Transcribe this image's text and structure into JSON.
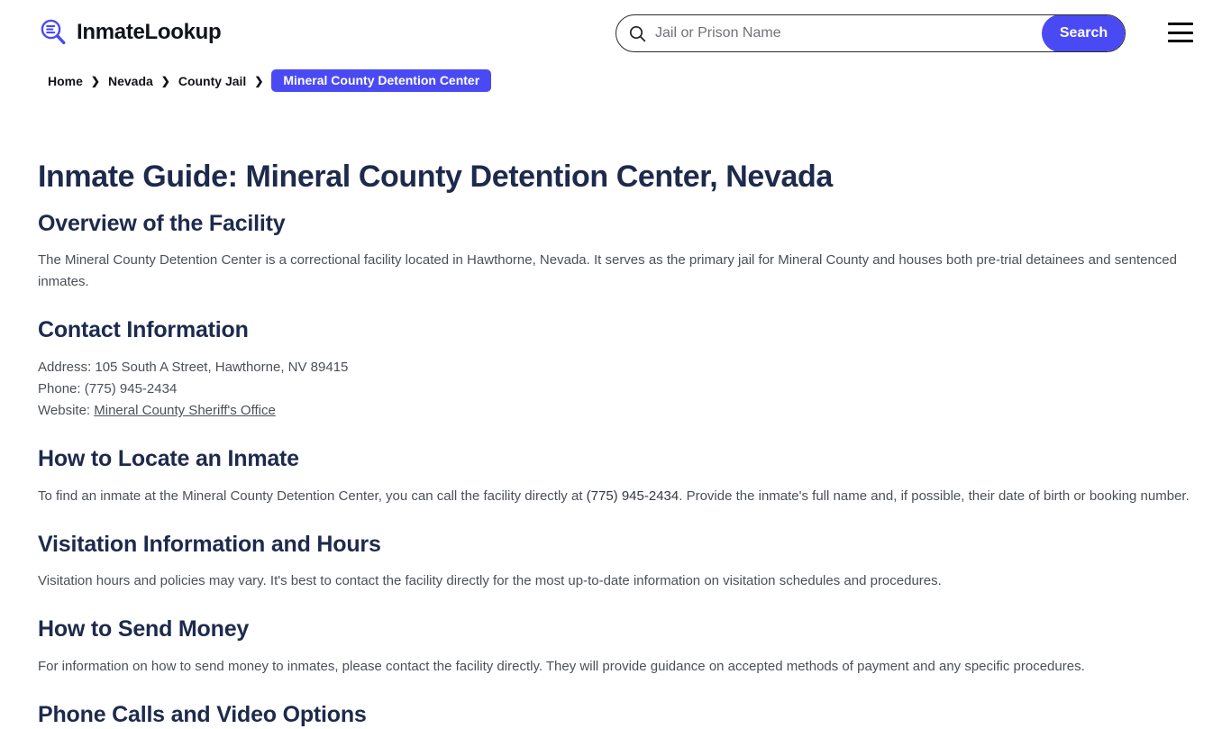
{
  "header": {
    "brand_name": "InmateLookup",
    "logo_icon": "magnifier-list-icon",
    "search": {
      "icon": "search-icon",
      "placeholder": "Jail or Prison Name",
      "value": "",
      "button_label": "Search"
    },
    "menu_icon": "hamburger-menu-icon",
    "accent_color": "#4a4af4"
  },
  "breadcrumb": {
    "items": [
      {
        "label": "Home"
      },
      {
        "label": "Nevada"
      },
      {
        "label": "County Jail"
      }
    ],
    "separator": "❯",
    "current": "Mineral County Detention Center"
  },
  "main": {
    "page_title": "Inmate Guide: Mineral County Detention Center, Nevada",
    "sections": [
      {
        "heading": "Overview of the Facility",
        "body": "The Mineral County Detention Center is a correctional facility located in Hawthorne, Nevada. It serves as the primary jail for Mineral County and houses both pre-trial detainees and sentenced inmates."
      },
      {
        "heading": "Contact Information",
        "address_line": "Address: 105 South A Street, Hawthorne, NV 89415",
        "phone_line": "Phone: (775) 945-2434",
        "website_label": "Website:",
        "website_link_text": "Mineral County Sheriff's Office"
      },
      {
        "heading": "How to Locate an Inmate",
        "body_before": "To find an inmate at the Mineral County Detention Center, you can call the facility directly at ",
        "body_phone": "(775) 945-2434",
        "body_after": ". Provide the inmate's full name and, if possible, their date of birth or booking number."
      },
      {
        "heading": "Visitation Information and Hours",
        "body": "Visitation hours and policies may vary. It's best to contact the facility directly for the most up-to-date information on visitation schedules and procedures."
      },
      {
        "heading": "How to Send Money",
        "body": "For information on how to send money to inmates, please contact the facility directly. They will provide guidance on accepted methods of payment and any specific procedures."
      },
      {
        "heading": "Phone Calls and Video Options"
      }
    ]
  }
}
